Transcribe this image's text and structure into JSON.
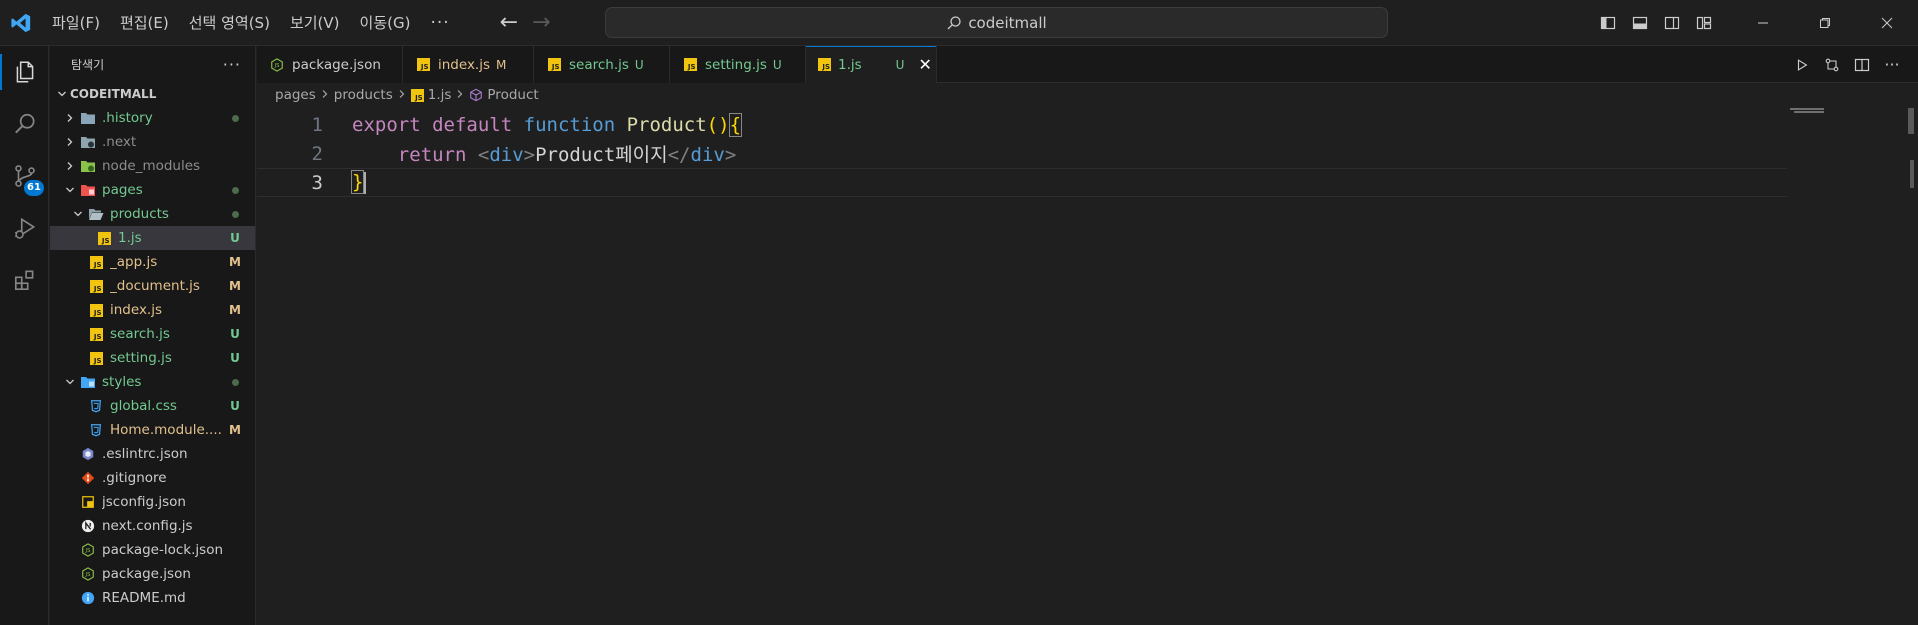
{
  "menu": {
    "items": [
      "파일(F)",
      "편집(E)",
      "선택 영역(S)",
      "보기(V)",
      "이동(G)"
    ],
    "more": "···"
  },
  "command_center": {
    "text": "codeitmall"
  },
  "activity_bar": {
    "items": [
      {
        "name": "explorer",
        "icon": "files-icon"
      },
      {
        "name": "search",
        "icon": "search-icon"
      },
      {
        "name": "source-control",
        "icon": "source-control-icon",
        "badge": "61"
      },
      {
        "name": "run-debug",
        "icon": "run-debug-icon"
      },
      {
        "name": "extensions",
        "icon": "extensions-icon"
      }
    ]
  },
  "sidebar": {
    "title": "탐색기",
    "more": "···",
    "folder": "CODEITMALL",
    "tree": [
      {
        "label": ".history",
        "type": "folder",
        "indent": 0,
        "color": "untracked",
        "deco": "dot",
        "chevron": "right",
        "icon": "history-folder-icon"
      },
      {
        "label": ".next",
        "type": "folder",
        "indent": 0,
        "color": "ignored",
        "deco": "",
        "chevron": "right",
        "icon": "next-folder-icon"
      },
      {
        "label": "node_modules",
        "type": "folder",
        "indent": 0,
        "color": "ignored",
        "deco": "",
        "chevron": "right",
        "icon": "node-folder-icon"
      },
      {
        "label": "pages",
        "type": "folder",
        "indent": 0,
        "color": "untracked",
        "deco": "dot",
        "chevron": "down",
        "icon": "pages-folder-icon"
      },
      {
        "label": "products",
        "type": "folder",
        "indent": 1,
        "color": "untracked",
        "deco": "dot",
        "chevron": "down",
        "icon": "folder-open-icon"
      },
      {
        "label": "1.js",
        "type": "file",
        "indent": 2,
        "color": "untracked",
        "deco": "U",
        "icon": "js-file-icon",
        "selected": true
      },
      {
        "label": "_app.js",
        "type": "file",
        "indent": 1,
        "color": "modified",
        "deco": "M",
        "icon": "js-file-icon"
      },
      {
        "label": "_document.js",
        "type": "file",
        "indent": 1,
        "color": "modified",
        "deco": "M",
        "icon": "js-file-icon"
      },
      {
        "label": "index.js",
        "type": "file",
        "indent": 1,
        "color": "modified",
        "deco": "M",
        "icon": "js-file-icon"
      },
      {
        "label": "search.js",
        "type": "file",
        "indent": 1,
        "color": "untracked",
        "deco": "U",
        "icon": "js-file-icon"
      },
      {
        "label": "setting.js",
        "type": "file",
        "indent": 1,
        "color": "untracked",
        "deco": "U",
        "icon": "js-file-icon"
      },
      {
        "label": "styles",
        "type": "folder",
        "indent": 0,
        "color": "untracked",
        "deco": "dot",
        "chevron": "down",
        "icon": "styles-folder-icon"
      },
      {
        "label": "global.css",
        "type": "file",
        "indent": 1,
        "color": "untracked",
        "deco": "U",
        "icon": "css-file-icon"
      },
      {
        "label": "Home.module....",
        "type": "file",
        "indent": 1,
        "color": "modified",
        "deco": "M",
        "icon": "css-file-icon"
      },
      {
        "label": ".eslintrc.json",
        "type": "file",
        "indent": 0,
        "color": "normal",
        "deco": "",
        "icon": "eslint-file-icon"
      },
      {
        "label": ".gitignore",
        "type": "file",
        "indent": 0,
        "color": "normal",
        "deco": "",
        "icon": "git-file-icon"
      },
      {
        "label": "jsconfig.json",
        "type": "file",
        "indent": 0,
        "color": "normal",
        "deco": "",
        "icon": "jsconfig-file-icon"
      },
      {
        "label": "next.config.js",
        "type": "file",
        "indent": 0,
        "color": "normal",
        "deco": "",
        "icon": "next-file-icon"
      },
      {
        "label": "package-lock.json",
        "type": "file",
        "indent": 0,
        "color": "normal",
        "deco": "",
        "icon": "node-file-icon"
      },
      {
        "label": "package.json",
        "type": "file",
        "indent": 0,
        "color": "normal",
        "deco": "",
        "icon": "node-file-icon"
      },
      {
        "label": "README.md",
        "type": "file",
        "indent": 0,
        "color": "normal",
        "deco": "",
        "icon": "info-file-icon"
      }
    ]
  },
  "tabs": [
    {
      "label": "package.json",
      "status": "",
      "color": "normal",
      "icon": "node-file-icon"
    },
    {
      "label": "index.js",
      "status": "M",
      "color": "modified",
      "icon": "js-file-icon"
    },
    {
      "label": "search.js",
      "status": "U",
      "color": "untracked",
      "icon": "js-file-icon"
    },
    {
      "label": "setting.js",
      "status": "U",
      "color": "untracked",
      "icon": "js-file-icon"
    },
    {
      "label": "1.js",
      "status": "U",
      "color": "untracked",
      "icon": "js-file-icon",
      "active": true,
      "close": "✕"
    }
  ],
  "breadcrumb": {
    "parts": [
      "pages",
      "products",
      "1.js",
      "Product"
    ],
    "separator": ">"
  },
  "editor": {
    "lines": [
      {
        "number": "1"
      },
      {
        "number": "2"
      },
      {
        "number": "3"
      }
    ],
    "code": {
      "l1_export": "export",
      "l1_default": "default",
      "l1_function": "function",
      "l1_name": "Product",
      "l1_parens": "()",
      "l1_brace": "{",
      "l2_return": "return",
      "l2_open_lt": "<",
      "l2_open_tag": "div",
      "l2_open_gt": ">",
      "l2_text": "Product페이지",
      "l2_close_lt": "</",
      "l2_close_tag": "div",
      "l2_close_gt": ">",
      "l3_brace": "}"
    }
  },
  "colors": {
    "accent": "#0078d4",
    "untracked": "#73c991",
    "modified": "#e2c08d",
    "js_icon": "#f1c40f",
    "css_icon": "#42a5f5"
  }
}
